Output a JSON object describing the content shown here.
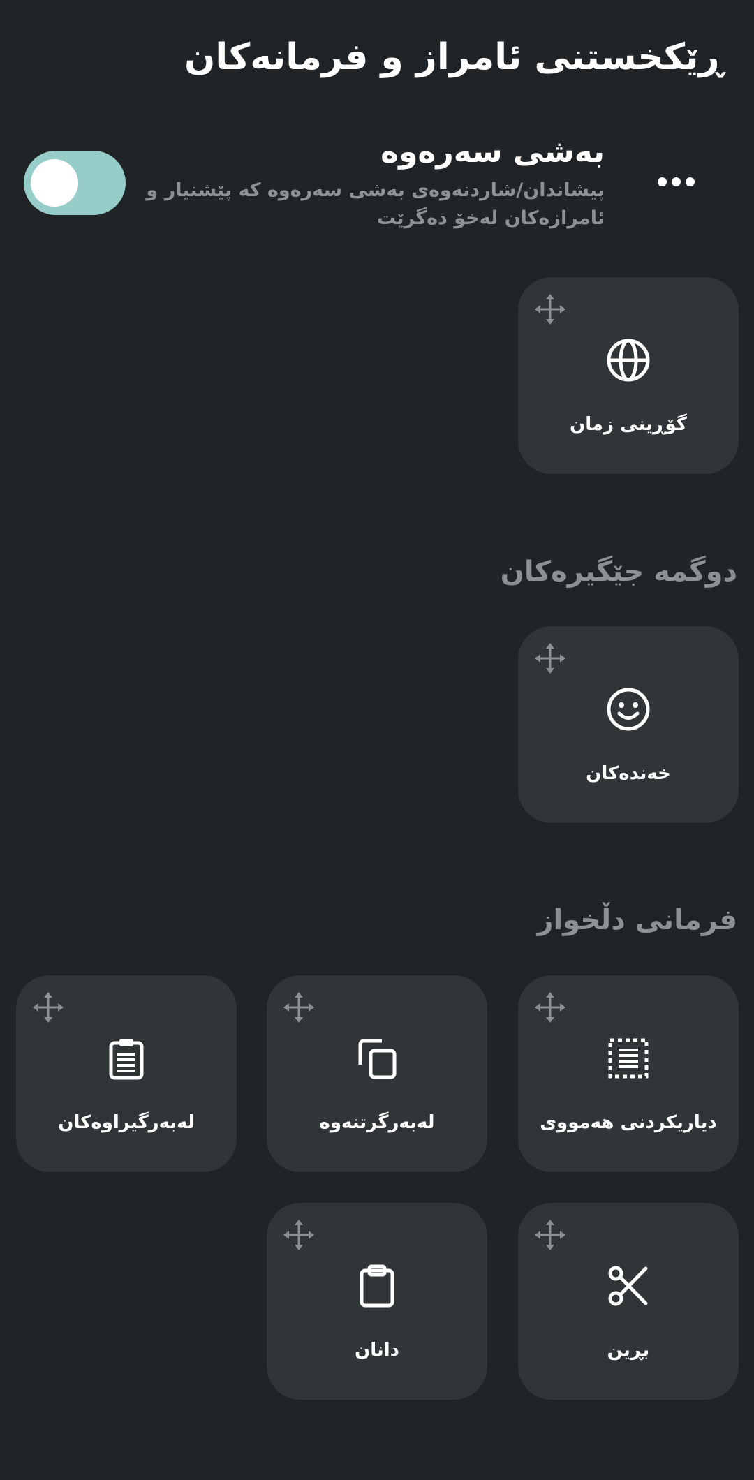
{
  "page": {
    "title": "ڕێکخستنی ئامراز و فرمانەکان"
  },
  "toolbar": {
    "title": "بەشی سەرەوە",
    "description": "پیشاندان/شاردنەوەی بەشی سەرەوە کە پێشنیار و ئامرازەکان لەخۆ دەگرێت",
    "toggle_on": true,
    "more_icon": "more-horiz-icon"
  },
  "sections": {
    "fixed_buttons": "دوگمە جێگیرەکان",
    "custom_commands": "فرمانی دڵخواز"
  },
  "tiles": {
    "change_language": {
      "label": "گۆڕینی زمان",
      "icon": "globe-icon"
    },
    "emojis": {
      "label": "خەندەکان",
      "icon": "smiley-icon"
    },
    "select_all": {
      "label": "دیاریکردنی هەمووی",
      "icon": "select-all-icon"
    },
    "copy": {
      "label": "لەبەرگرتنەوە",
      "icon": "copy-icon"
    },
    "clipboard": {
      "label": "لەبەرگیراوەکان",
      "icon": "clipboard-list-icon"
    },
    "cut": {
      "label": "بڕین",
      "icon": "scissors-icon"
    },
    "paste": {
      "label": "دانان",
      "icon": "paste-icon"
    }
  },
  "colors": {
    "background": "#202427",
    "tile": "#303538",
    "toggle_track": "#97cdc9",
    "secondary_text": "#8c9196"
  }
}
